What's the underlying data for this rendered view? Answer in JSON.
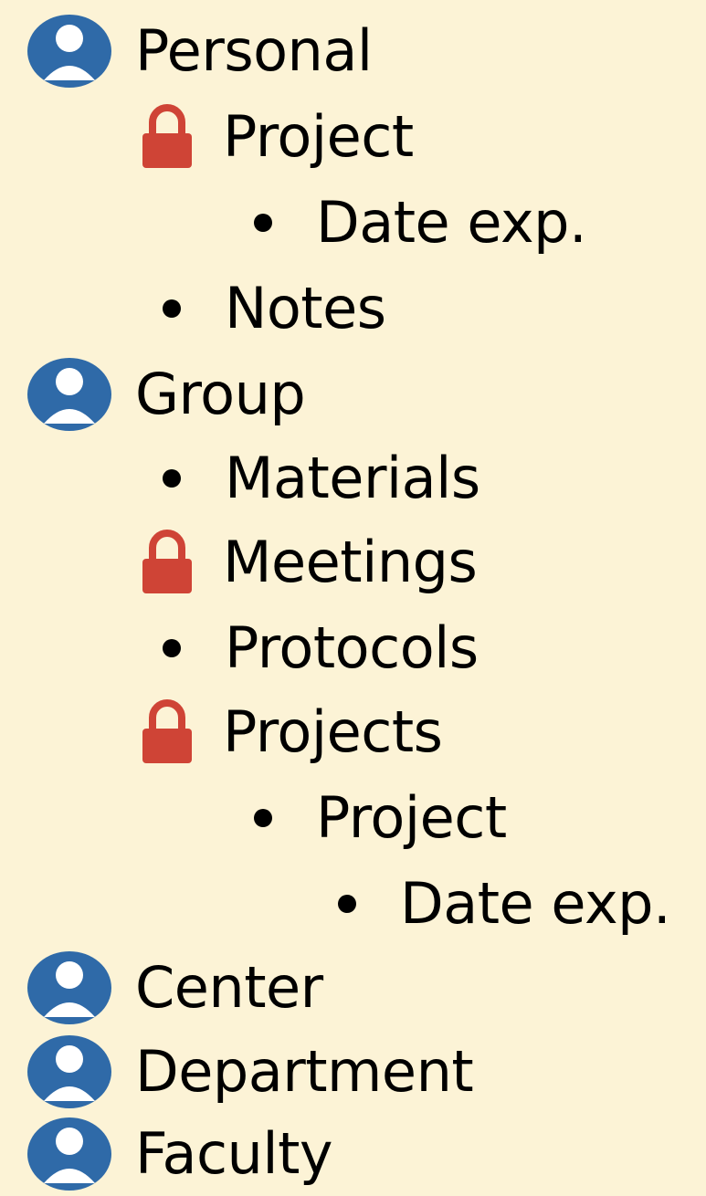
{
  "colors": {
    "background": "#fcf3d6",
    "user_icon": "#2f6aa8",
    "lock_icon": "#cf4436",
    "text": "#000000"
  },
  "tree": [
    {
      "label": "Personal",
      "marker": "user-icon",
      "level": 0
    },
    {
      "label": "Project",
      "marker": "lock-icon",
      "level": 1
    },
    {
      "label": "Date exp.",
      "marker": "bullet",
      "level": 2
    },
    {
      "label": "Notes",
      "marker": "bullet",
      "level": 1
    },
    {
      "label": "Group",
      "marker": "user-icon",
      "level": 0
    },
    {
      "label": "Materials",
      "marker": "bullet",
      "level": 1
    },
    {
      "label": "Meetings",
      "marker": "lock-icon",
      "level": 1
    },
    {
      "label": "Protocols",
      "marker": "bullet",
      "level": 1
    },
    {
      "label": "Projects",
      "marker": "lock-icon",
      "level": 1
    },
    {
      "label": "Project",
      "marker": "bullet",
      "level": 2
    },
    {
      "label": "Date exp.",
      "marker": "bullet",
      "level": 3
    },
    {
      "label": "Center",
      "marker": "user-icon",
      "level": 0
    },
    {
      "label": "Department",
      "marker": "user-icon",
      "level": 0
    },
    {
      "label": "Faculty",
      "marker": "user-icon",
      "level": 0
    }
  ]
}
